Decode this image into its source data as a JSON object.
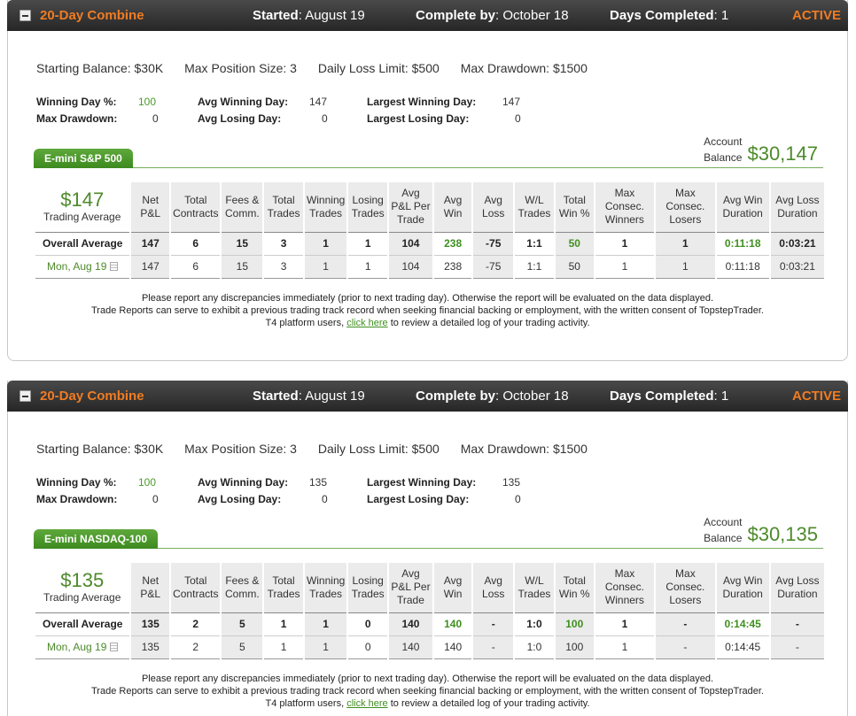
{
  "panels": [
    {
      "title": "20-Day Combine",
      "started_label": "Started",
      "started_value": ": August 19",
      "complete_label": "Complete by",
      "complete_value": ": October 18",
      "days_label": "Days Completed",
      "days_value": ": 1",
      "status": "ACTIVE",
      "rules": {
        "starting_balance": "Starting Balance: $30K",
        "max_position": "Max Position Size: 3",
        "daily_loss": "Daily Loss Limit: $500",
        "max_drawdown": "Max Drawdown: $1500"
      },
      "stats": {
        "winning_day_pct_label": "Winning Day %:",
        "winning_day_pct": "100",
        "avg_winning_day_label": "Avg Winning Day:",
        "avg_winning_day": "147",
        "largest_winning_day_label": "Largest Winning Day:",
        "largest_winning_day": "147",
        "max_drawdown_label": "Max Drawdown:",
        "max_drawdown": "0",
        "avg_losing_day_label": "Avg Losing Day:",
        "avg_losing_day": "0",
        "largest_losing_day_label": "Largest Losing Day:",
        "largest_losing_day": "0"
      },
      "product": "E-mini S&P 500",
      "account_balance_label_1": "Account",
      "account_balance_label_2": "Balance",
      "account_balance": "$30,147",
      "trading_average_value": "$147",
      "trading_average_label": "Trading Average",
      "columns": [
        "Net P&L",
        "Total Contracts",
        "Fees & Comm.",
        "Total Trades",
        "Winning Trades",
        "Losing Trades",
        "Avg P&L Per Trade",
        "Avg Win",
        "Avg Loss",
        "W/L Trades",
        "Total Win %",
        "Max Consec. Winners",
        "Max Consec. Losers",
        "Avg Win Duration",
        "Avg Loss Duration"
      ],
      "overall_label": "Overall Average",
      "overall": [
        "147",
        "6",
        "15",
        "3",
        "1",
        "1",
        "104",
        "238",
        "-75",
        "1:1",
        "50",
        "1",
        "1",
        "0:11:18",
        "0:03:21"
      ],
      "day_label": "Mon, Aug 19",
      "day": [
        "147",
        "6",
        "15",
        "3",
        "1",
        "1",
        "104",
        "238",
        "-75",
        "1:1",
        "50",
        "1",
        "1",
        "0:11:18",
        "0:03:21"
      ],
      "notice_1": "Please report any discrepancies immediately (prior to next trading day). Otherwise the report will be evaluated on the data displayed.",
      "notice_2": "Trade Reports can serve to exhibit a previous trading track record when seeking financial backing or employment, with the written consent of TopstepTrader.",
      "notice_3a": "T4 platform users, ",
      "notice_link": "click here",
      "notice_3b": " to review a detailed log of your trading activity."
    },
    {
      "title": "20-Day Combine",
      "started_label": "Started",
      "started_value": ": August 19",
      "complete_label": "Complete by",
      "complete_value": ": October 18",
      "days_label": "Days Completed",
      "days_value": ": 1",
      "status": "ACTIVE",
      "rules": {
        "starting_balance": "Starting Balance: $30K",
        "max_position": "Max Position Size: 3",
        "daily_loss": "Daily Loss Limit: $500",
        "max_drawdown": "Max Drawdown: $1500"
      },
      "stats": {
        "winning_day_pct_label": "Winning Day %:",
        "winning_day_pct": "100",
        "avg_winning_day_label": "Avg Winning Day:",
        "avg_winning_day": "135",
        "largest_winning_day_label": "Largest Winning Day:",
        "largest_winning_day": "135",
        "max_drawdown_label": "Max Drawdown:",
        "max_drawdown": "0",
        "avg_losing_day_label": "Avg Losing Day:",
        "avg_losing_day": "0",
        "largest_losing_day_label": "Largest Losing Day:",
        "largest_losing_day": "0"
      },
      "product": "E-mini NASDAQ-100",
      "account_balance_label_1": "Account",
      "account_balance_label_2": "Balance",
      "account_balance": "$30,135",
      "trading_average_value": "$135",
      "trading_average_label": "Trading Average",
      "columns": [
        "Net P&L",
        "Total Contracts",
        "Fees & Comm.",
        "Total Trades",
        "Winning Trades",
        "Losing Trades",
        "Avg P&L Per Trade",
        "Avg Win",
        "Avg Loss",
        "W/L Trades",
        "Total Win %",
        "Max Consec. Winners",
        "Max Consec. Losers",
        "Avg Win Duration",
        "Avg Loss Duration"
      ],
      "overall_label": "Overall Average",
      "overall": [
        "135",
        "2",
        "5",
        "1",
        "1",
        "0",
        "140",
        "140",
        "-",
        "1:0",
        "100",
        "1",
        "-",
        "0:14:45",
        "-"
      ],
      "day_label": "Mon, Aug 19",
      "day": [
        "135",
        "2",
        "5",
        "1",
        "1",
        "0",
        "140",
        "140",
        "-",
        "1:0",
        "100",
        "1",
        "-",
        "0:14:45",
        "-"
      ],
      "notice_1": "Please report any discrepancies immediately (prior to next trading day). Otherwise the report will be evaluated on the data displayed.",
      "notice_2": "Trade Reports can serve to exhibit a previous trading track record when seeking financial backing or employment, with the written consent of TopstepTrader.",
      "notice_3a": "T4 platform users, ",
      "notice_link": "click here",
      "notice_3b": " to review a detailed log of your trading activity."
    }
  ]
}
